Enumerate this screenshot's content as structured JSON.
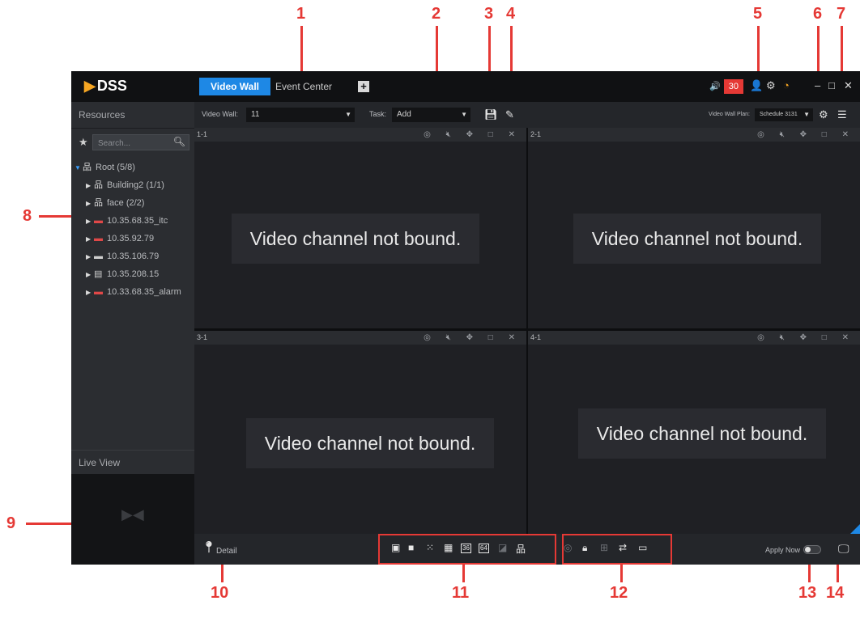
{
  "callouts": [
    "1",
    "2",
    "3",
    "4",
    "5",
    "6",
    "7",
    "8",
    "9",
    "10",
    "11",
    "12",
    "13",
    "14"
  ],
  "titlebar": {
    "logo_text": "DSS",
    "tabs": [
      {
        "label": "Video Wall",
        "active": true
      },
      {
        "label": "Event Center",
        "active": false
      }
    ],
    "add_tab_symbol": "+",
    "alarm_count": "30",
    "colors": {
      "accent": "#1e88e5",
      "alarm": "#e53935"
    }
  },
  "sidebar": {
    "resources_label": "Resources",
    "search_placeholder": "Search...",
    "tree": [
      {
        "label": "Root (5/8)",
        "icon": "org-icon",
        "level": 0,
        "expanded": true
      },
      {
        "label": "Building2 (1/1)",
        "icon": "org-icon",
        "level": 1
      },
      {
        "label": "face (2/2)",
        "icon": "org-icon",
        "level": 1
      },
      {
        "label": "10.35.68.35_itc",
        "icon": "device-icon",
        "level": 1
      },
      {
        "label": "10.35.92.79",
        "icon": "device-icon",
        "level": 1
      },
      {
        "label": "10.35.106.79",
        "icon": "device-icon",
        "level": 1
      },
      {
        "label": "10.35.208.15",
        "icon": "server-icon",
        "level": 1
      },
      {
        "label": "10.33.68.35_alarm",
        "icon": "device-icon",
        "level": 1
      }
    ],
    "live_view_label": "Live View"
  },
  "toolbar": {
    "video_wall_label": "Video Wall:",
    "video_wall_value": "11",
    "task_label": "Task:",
    "task_value": "Add",
    "plan_label": "Video Wall Plan:",
    "plan_value": "Schedule 3131"
  },
  "cells": [
    {
      "id": "1-1",
      "message": "Video channel not bound."
    },
    {
      "id": "2-1",
      "message": "Video channel not bound."
    },
    {
      "id": "3-1",
      "message": "Video channel not bound."
    },
    {
      "id": "4-1",
      "message": "Video channel not bound."
    }
  ],
  "bottombar": {
    "detail_label": "Detail",
    "layout_36": "36",
    "layout_64": "64",
    "apply_now_label": "Apply Now",
    "apply_now_on": false
  }
}
